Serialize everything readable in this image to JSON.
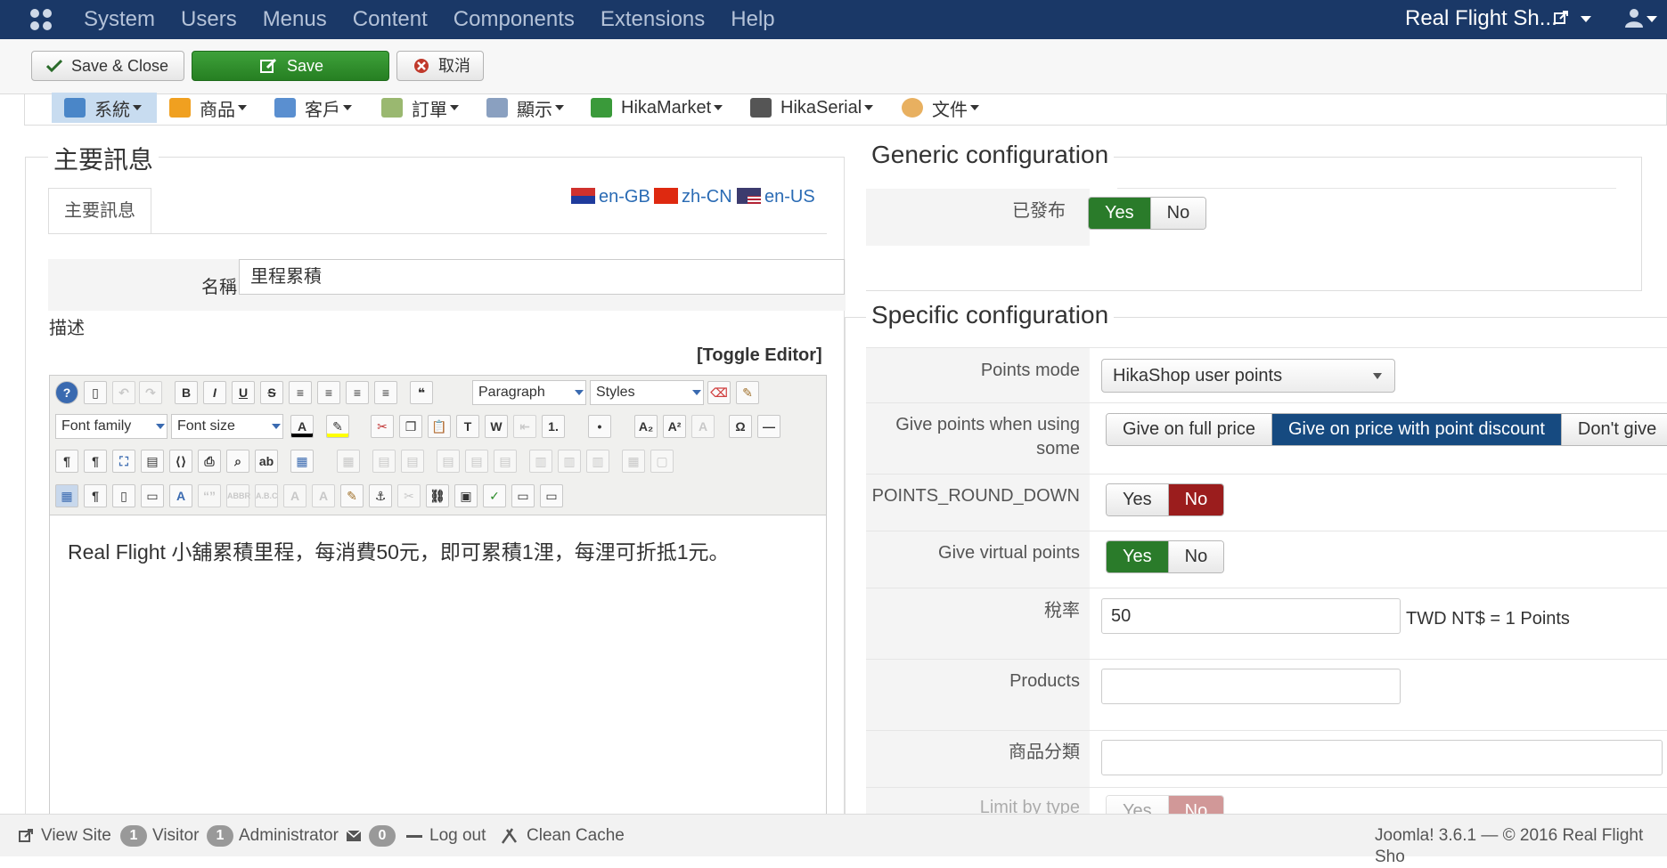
{
  "topbar": {
    "menu": [
      "System",
      "Users",
      "Menus",
      "Content",
      "Components",
      "Extensions",
      "Help"
    ],
    "site_title": "Real Flight Sh..."
  },
  "toolbar": {
    "save_close": "Save & Close",
    "save": "Save",
    "cancel": "取消"
  },
  "hikabar": {
    "items": [
      "系統",
      "商品",
      "客戶",
      "訂單",
      "顯示",
      "HikaMarket",
      "HikaSerial",
      "文件"
    ]
  },
  "main_info": {
    "legend": "主要訊息",
    "tab": "主要訊息",
    "languages": [
      "en-GB",
      "zh-CN",
      "en-US"
    ],
    "name_label": "名稱",
    "name_value": "里程累積",
    "desc_label": "描述",
    "toggle_editor": "[Toggle Editor]",
    "editor_content": "Real Flight 小舖累積里程，每消費50元，即可累積1浬，每浬可折抵1元。"
  },
  "editor": {
    "paragraph": "Paragraph",
    "styles": "Styles",
    "font_family": "Font family",
    "font_size": "Font size"
  },
  "generic": {
    "legend": "Generic configuration",
    "published_label": "已發布",
    "yes": "Yes",
    "no": "No"
  },
  "specific": {
    "legend": "Specific configuration",
    "points_mode_label": "Points mode",
    "points_mode_value": "HikaShop user points",
    "give_points_label": "Give points when using some",
    "give_full": "Give on full price",
    "give_discount": "Give on price with point discount",
    "dont_give": "Don't give",
    "round_down_label": "POINTS_ROUND_DOWN",
    "virtual_label": "Give virtual points",
    "rate_label": "稅率",
    "rate_value": "50",
    "rate_suffix": "TWD NT$ = 1 Points",
    "products_label": "Products",
    "category_label": "商品分類",
    "limit_label": "Limit by type",
    "yes": "Yes",
    "no": "No"
  },
  "statusbar": {
    "view_site": "View Site",
    "visitor_count": "1",
    "visitor": "Visitor",
    "admin_count": "1",
    "admin": "Administrator",
    "msg_count": "0",
    "logout": "Log out",
    "clean_cache": "Clean Cache",
    "version": "Joomla! 3.6.1  —  © 2016 Real Flight Sho"
  },
  "colors": {
    "topbar": "#1a3867",
    "save_green": "#2a8a27",
    "yes_green": "#2a7b2a",
    "no_red": "#9b1d1d",
    "selected_blue": "#164a80"
  }
}
